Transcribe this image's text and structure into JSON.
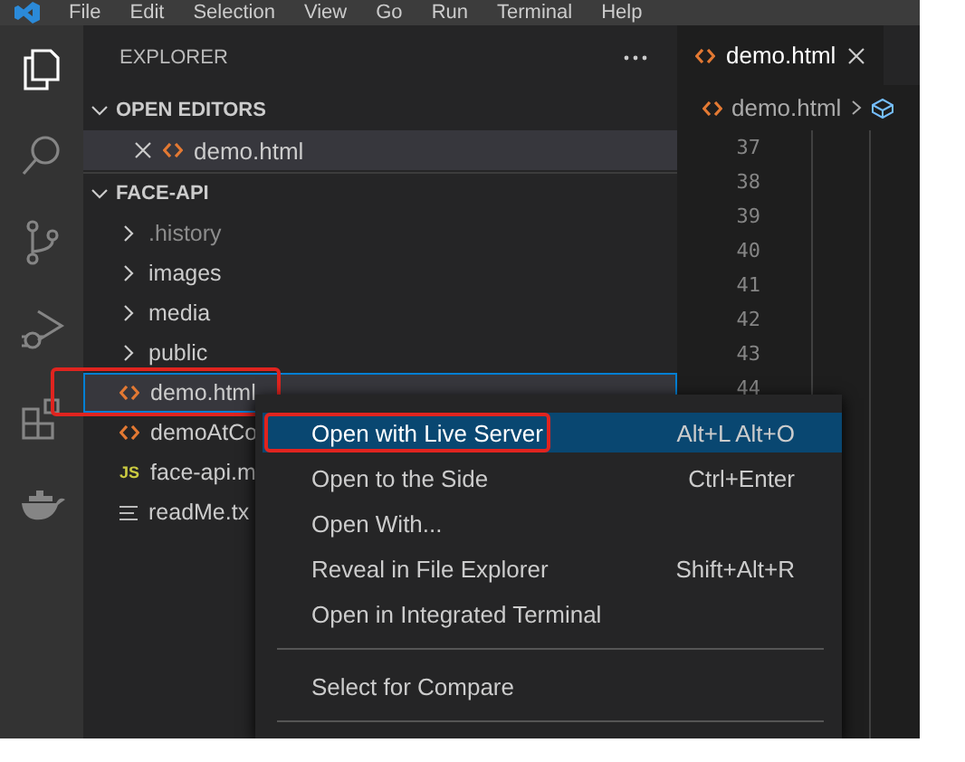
{
  "menu_bar": [
    "File",
    "Edit",
    "Selection",
    "View",
    "Go",
    "Run",
    "Terminal",
    "Help"
  ],
  "activity_bar": [
    {
      "kind": "files",
      "selected": true
    },
    {
      "kind": "search",
      "selected": false
    },
    {
      "kind": "source-control",
      "selected": false
    },
    {
      "kind": "debug",
      "selected": false
    },
    {
      "kind": "extensions",
      "selected": false
    },
    {
      "kind": "docker",
      "selected": false
    }
  ],
  "explorer": {
    "title": "EXPLORER",
    "open_editors": {
      "title": "OPEN EDITORS",
      "expanded": true,
      "items": [
        {
          "name": "demo.html",
          "kind": "html"
        }
      ]
    },
    "folder": {
      "title": "FACE-API",
      "expanded": true,
      "items": [
        {
          "name": ".history",
          "kind": "folder",
          "expanded": false,
          "dimmed": true,
          "selected": false,
          "callout": false
        },
        {
          "name": "images",
          "kind": "folder",
          "expanded": false,
          "dimmed": false,
          "selected": false,
          "callout": false
        },
        {
          "name": "media",
          "kind": "folder",
          "expanded": false,
          "dimmed": false,
          "selected": false,
          "callout": false
        },
        {
          "name": "public",
          "kind": "folder",
          "expanded": false,
          "dimmed": false,
          "selected": false,
          "callout": false
        },
        {
          "name": "demo.html",
          "kind": "html",
          "dimmed": false,
          "selected": true,
          "callout": true
        },
        {
          "name": "demoAtCo",
          "kind": "html",
          "dimmed": false,
          "selected": false,
          "callout": false
        },
        {
          "name": "face-api.m",
          "kind": "js",
          "icon": "JS",
          "dimmed": false,
          "selected": false,
          "callout": false
        },
        {
          "name": "readMe.tx",
          "kind": "text",
          "dimmed": false,
          "selected": false,
          "callout": false
        }
      ]
    }
  },
  "editor": {
    "tab": {
      "label": "demo.html",
      "selected": true
    },
    "breadcrumb": "demo.html",
    "line_numbers": [
      "37",
      "38",
      "39",
      "40",
      "41",
      "42",
      "43",
      "44"
    ]
  },
  "context_menu": [
    {
      "kind": "item",
      "label": "Open with Live Server",
      "shortcut": "Alt+L Alt+O",
      "selected": true,
      "callout": true
    },
    {
      "kind": "item",
      "label": "Open to the Side",
      "shortcut": "Ctrl+Enter",
      "selected": false,
      "callout": false
    },
    {
      "kind": "item",
      "label": "Open With...",
      "selected": false,
      "callout": false
    },
    {
      "kind": "item",
      "label": "Reveal in File Explorer",
      "shortcut": "Shift+Alt+R",
      "selected": false,
      "callout": false
    },
    {
      "kind": "item",
      "label": "Open in Integrated Terminal",
      "selected": false,
      "callout": false
    },
    {
      "kind": "separator"
    },
    {
      "kind": "item",
      "label": "Select for Compare",
      "selected": false,
      "callout": false
    },
    {
      "kind": "separator"
    }
  ]
}
